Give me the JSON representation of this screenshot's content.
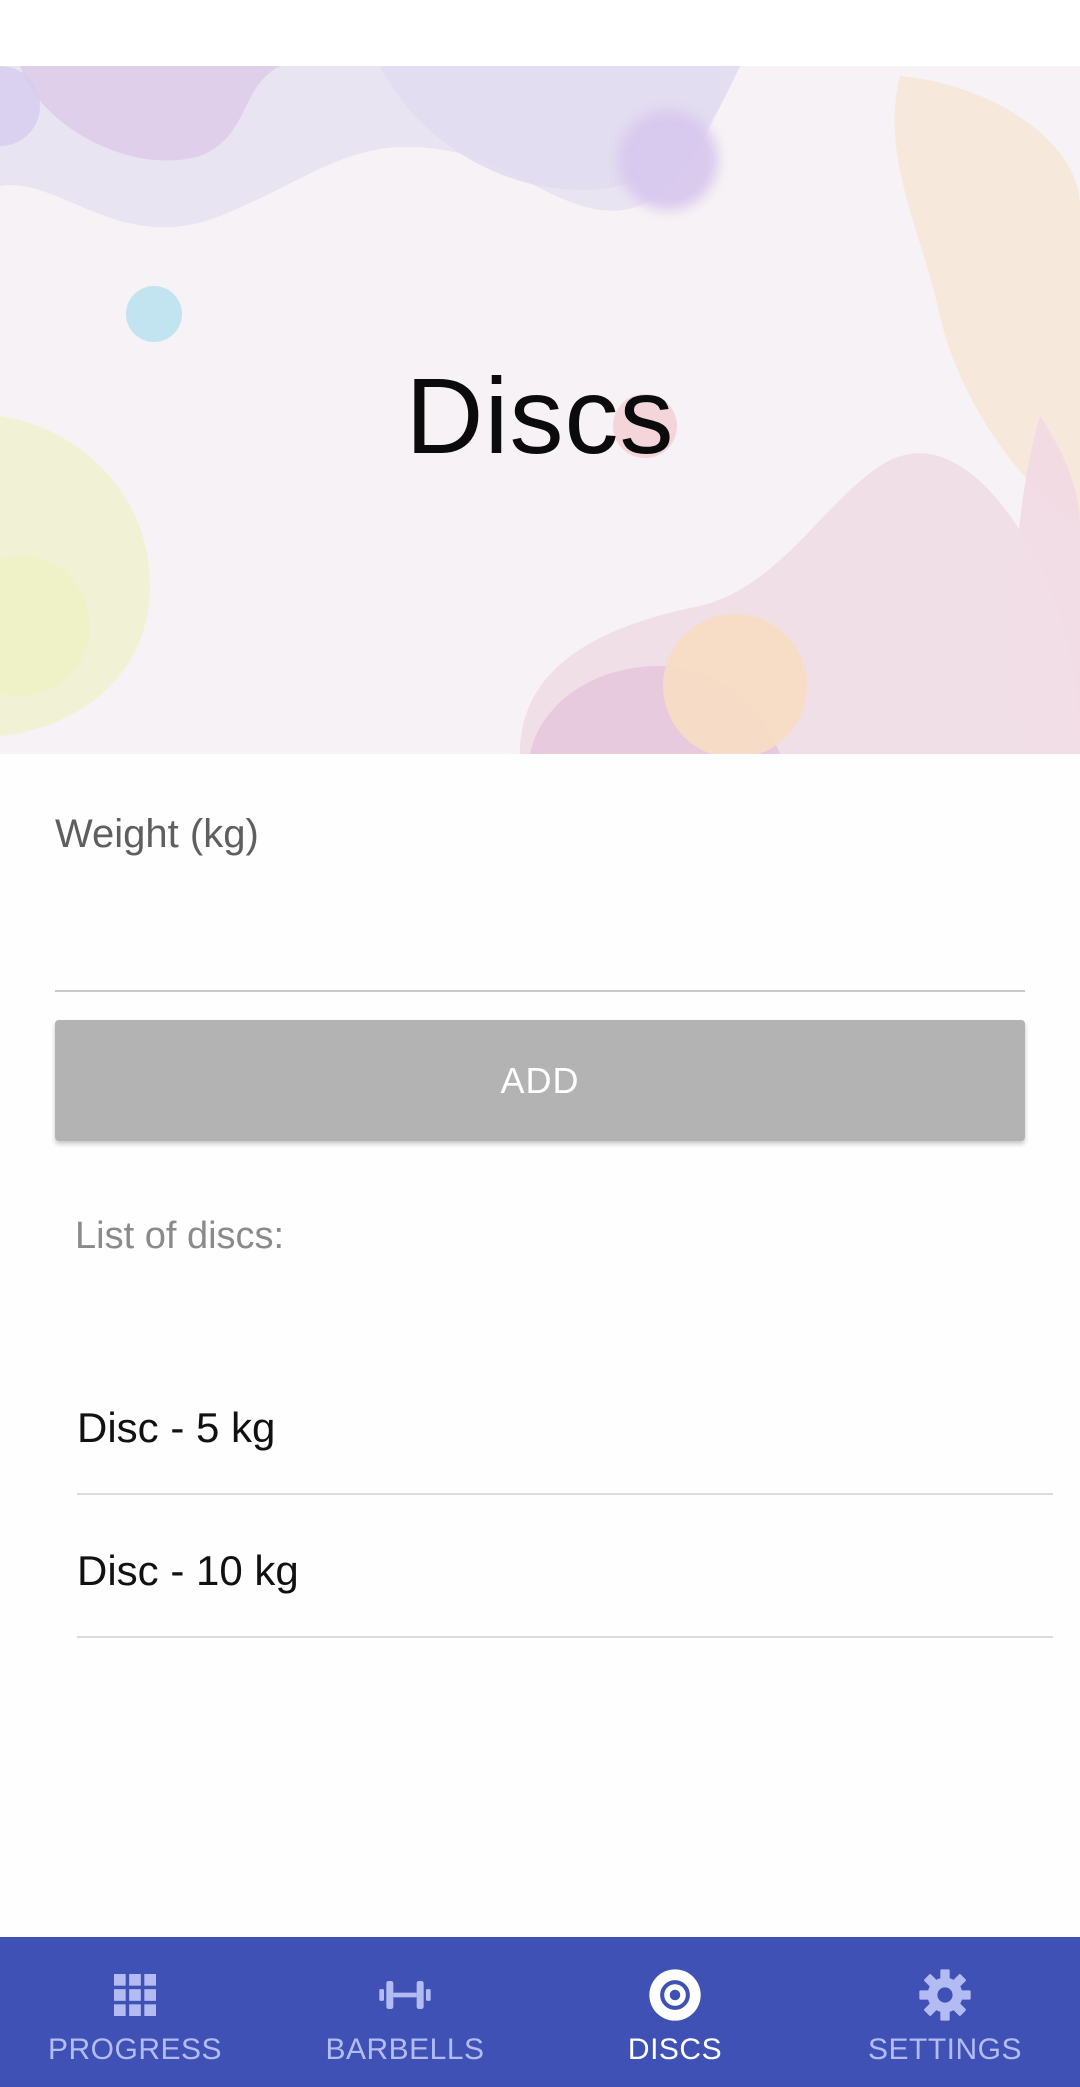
{
  "hero": {
    "title": "Discs"
  },
  "form": {
    "weight_label": "Weight (kg)",
    "weight_value": "",
    "add_label": "ADD"
  },
  "list": {
    "heading": "List of discs:",
    "items": [
      {
        "label": "Disc - 5 kg"
      },
      {
        "label": "Disc - 10 kg"
      }
    ]
  },
  "nav": {
    "items": [
      {
        "label": "PROGRESS",
        "icon": "grid-icon",
        "active": false
      },
      {
        "label": "BARBELLS",
        "icon": "barbell-icon",
        "active": false
      },
      {
        "label": "DISCS",
        "icon": "disc-icon",
        "active": true
      },
      {
        "label": "SETTINGS",
        "icon": "gear-icon",
        "active": false
      }
    ]
  },
  "colors": {
    "nav_background": "#3f51b5",
    "nav_active": "#ffffff",
    "nav_inactive": "#b3bcf2",
    "button_disabled": "#b3b3b3"
  }
}
